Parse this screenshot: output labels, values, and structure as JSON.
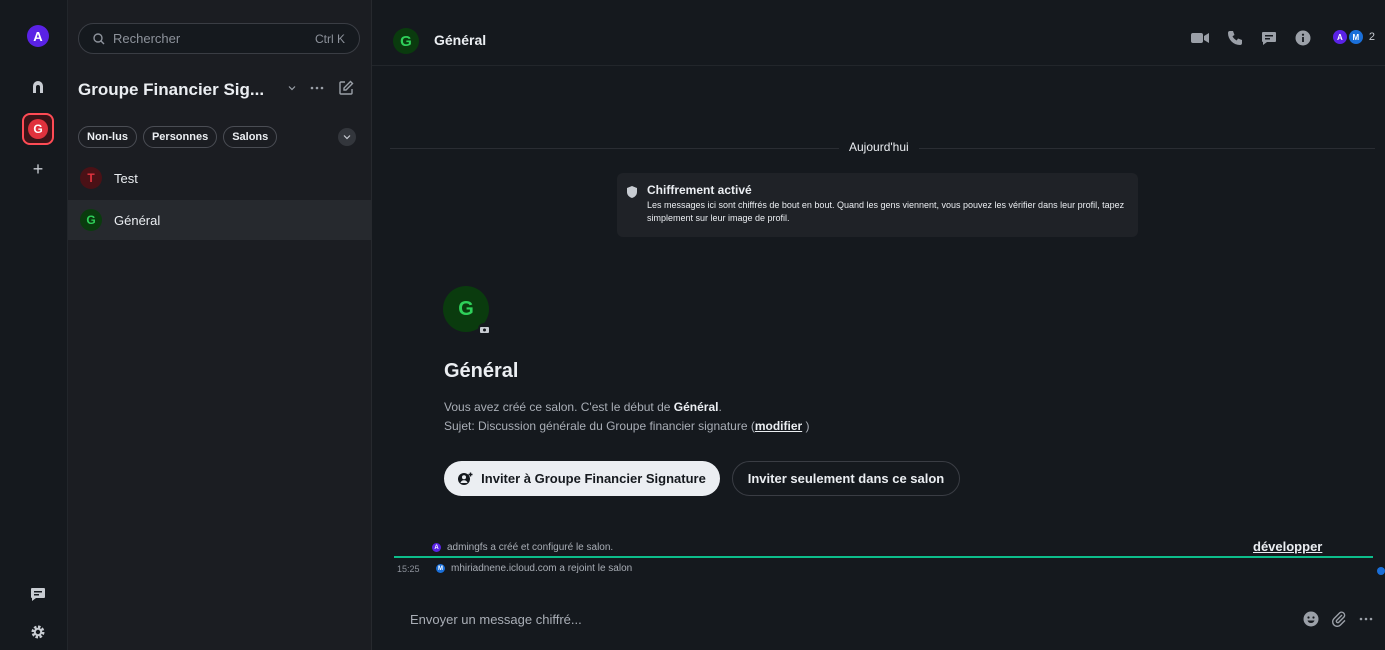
{
  "spacebar": {
    "user_initial": "A",
    "space_initial": "G",
    "add_label": "+"
  },
  "roomlist": {
    "search": {
      "placeholder": "Rechercher",
      "shortcut": "Ctrl K"
    },
    "space_title": "Groupe Financier Sig...",
    "filters": [
      "Non-lus",
      "Personnes",
      "Salons"
    ],
    "rooms": [
      {
        "initial": "T",
        "name": "Test",
        "color": "#e0323d",
        "bg": "#4a1116"
      },
      {
        "initial": "G",
        "name": "Général",
        "color": "#2fd05a",
        "bg": "#0a3b0e"
      }
    ]
  },
  "header": {
    "initial": "G",
    "title": "Général",
    "members": {
      "a": "A",
      "m": "M",
      "count": "2"
    }
  },
  "timeline": {
    "date": "Aujourd'hui",
    "encryption": {
      "title": "Chiffrement activé",
      "description": "Les messages ici sont chiffrés de bout en bout. Quand les gens viennent, vous pouvez les vérifier dans leur profil, tapez simplement sur leur image de profil."
    },
    "room_initial": "G",
    "room_name": "Général",
    "intro_prefix": "Vous avez créé ce salon. C'est le début de ",
    "intro_room": "Général",
    "intro_suffix": ".",
    "topic_prefix": "Sujet: Discussion générale du Groupe financier signature (",
    "topic_link": "modifier",
    "topic_suffix": " )",
    "invite_space_label": "Inviter à Groupe Financier Signature",
    "invite_room_label": "Inviter seulement dans ce salon",
    "event_created": "admingfs a créé et configuré le salon.",
    "expand_label": "développer",
    "event_time": "15:25",
    "event_joined": "mhiriadnene.icloud.com a rejoint le salon",
    "avatar_a": "A",
    "avatar_m": "M"
  },
  "composer": {
    "placeholder": "Envoyer un message chiffré..."
  },
  "colors": {
    "accent_green": "#0dbd8b",
    "user_purple": "#5a22e6",
    "space_red": "#e0323d"
  }
}
